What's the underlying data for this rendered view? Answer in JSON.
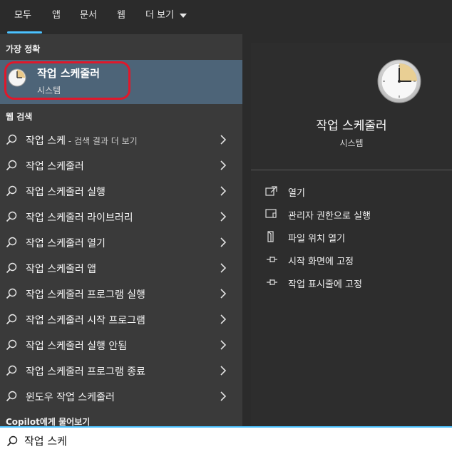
{
  "tabs": [
    {
      "label": "모두",
      "active": true
    },
    {
      "label": "앱"
    },
    {
      "label": "문서"
    },
    {
      "label": "웹"
    },
    {
      "label": "더 보기"
    }
  ],
  "best_match": {
    "heading": "가장 정확",
    "title": "작업 스케줄러",
    "subtitle": "시스템",
    "icon": "clock-icon"
  },
  "web_search": {
    "heading": "웹 검색",
    "items": [
      {
        "label": "작업 스케",
        "suffix": " - 검색 결과 더 보기"
      },
      {
        "label": "작업 스케줄러",
        "suffix": ""
      },
      {
        "label": "작업 스케줄러 실행",
        "suffix": ""
      },
      {
        "label": "작업 스케줄러 라이브러리",
        "suffix": ""
      },
      {
        "label": "작업 스케줄러 열기",
        "suffix": ""
      },
      {
        "label": "작업 스케줄러 앱",
        "suffix": ""
      },
      {
        "label": "작업 스케줄러 프로그램 실행",
        "suffix": ""
      },
      {
        "label": "작업 스케줄러 시작 프로그램",
        "suffix": ""
      },
      {
        "label": "작업 스케줄러 실행 안됨",
        "suffix": ""
      },
      {
        "label": "작업 스케줄러 프로그램 종료",
        "suffix": ""
      },
      {
        "label": "윈도우 작업 스케줄러",
        "suffix": ""
      }
    ]
  },
  "copilot": {
    "label": "Copilot에게 물어보기"
  },
  "detail": {
    "title": "작업 스케줄러",
    "subtitle": "시스템",
    "actions": [
      {
        "label": "열기",
        "icon": "open-icon"
      },
      {
        "label": "관리자 권한으로 실행",
        "icon": "shield-icon"
      },
      {
        "label": "파일 위치 열기",
        "icon": "folder-icon"
      },
      {
        "label": "시작 화면에 고정",
        "icon": "pin-icon"
      },
      {
        "label": "작업 표시줄에 고정",
        "icon": "pin-icon"
      }
    ]
  },
  "search": {
    "value": "작업 스케"
  },
  "colors": {
    "accent": "#4cc2ff",
    "highlight": "#e0182b",
    "selected_row": "#4d6478"
  }
}
